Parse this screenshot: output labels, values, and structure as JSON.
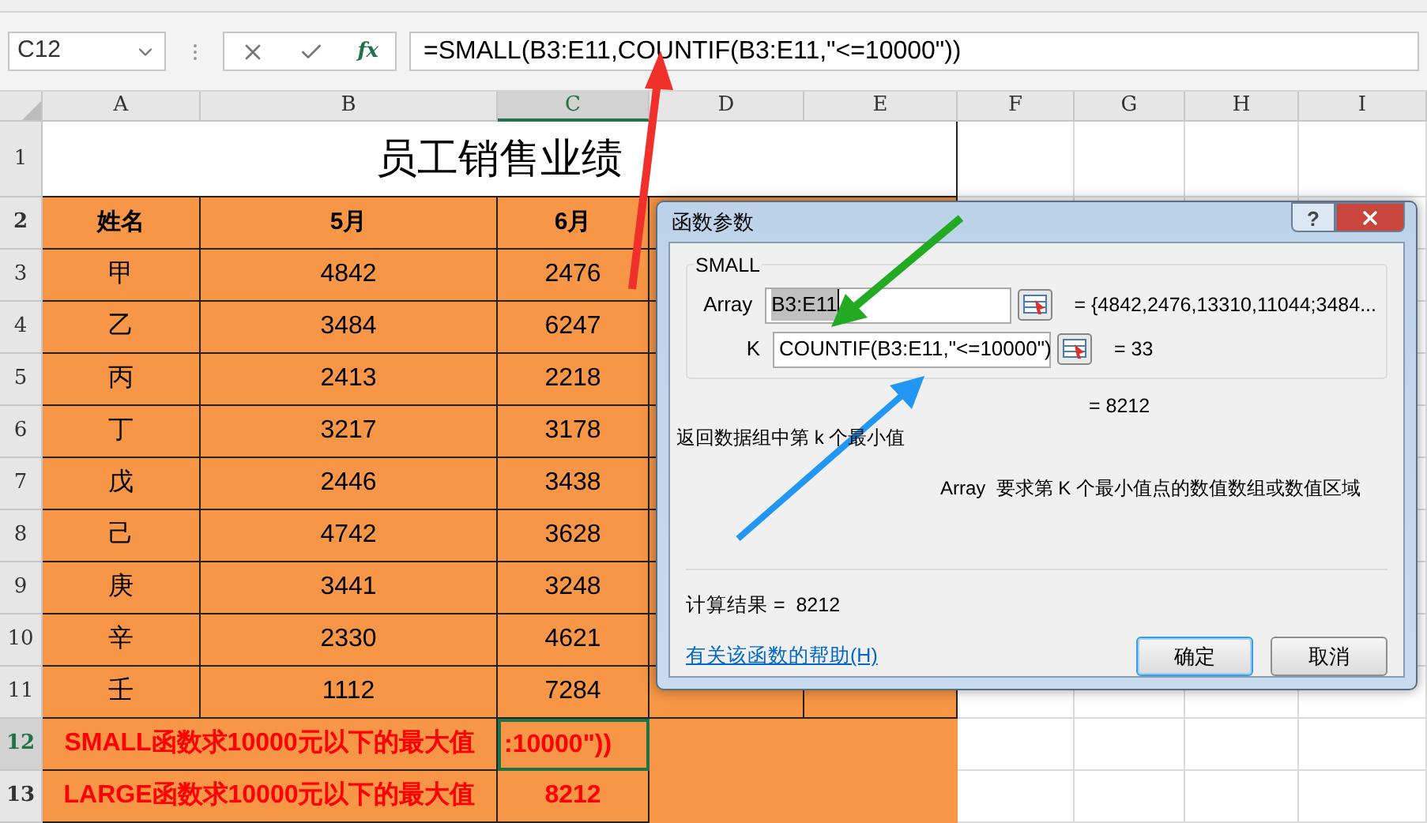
{
  "name_box": {
    "value": "C12"
  },
  "formula_bar": {
    "fx_label": "fx",
    "value": "=SMALL(B3:E11,COUNTIF(B3:E11,\"<=10000\"))"
  },
  "columns": [
    {
      "label": "A",
      "selected": false
    },
    {
      "label": "B",
      "selected": false
    },
    {
      "label": "C",
      "selected": true
    },
    {
      "label": "D",
      "selected": false
    },
    {
      "label": "E",
      "selected": false
    },
    {
      "label": "F",
      "selected": false
    },
    {
      "label": "G",
      "selected": false
    },
    {
      "label": "H",
      "selected": false
    },
    {
      "label": "I",
      "selected": false
    }
  ],
  "row_numbers": [
    {
      "label": "1",
      "selected": false
    },
    {
      "label": "2",
      "selected": false
    },
    {
      "label": "3",
      "selected": false
    },
    {
      "label": "4",
      "selected": false
    },
    {
      "label": "5",
      "selected": false
    },
    {
      "label": "6",
      "selected": false
    },
    {
      "label": "7",
      "selected": false
    },
    {
      "label": "8",
      "selected": false
    },
    {
      "label": "9",
      "selected": false
    },
    {
      "label": "10",
      "selected": false
    },
    {
      "label": "11",
      "selected": false
    },
    {
      "label": "12",
      "selected": true
    },
    {
      "label": "13",
      "selected": false
    }
  ],
  "sheet": {
    "title": "员工销售业绩",
    "headers": [
      "姓名",
      "5月",
      "6月"
    ],
    "rows": [
      {
        "name": "甲",
        "may": "4842",
        "june": "2476"
      },
      {
        "name": "乙",
        "may": "3484",
        "june": "6247"
      },
      {
        "name": "丙",
        "may": "2413",
        "june": "2218"
      },
      {
        "name": "丁",
        "may": "3217",
        "june": "3178"
      },
      {
        "name": "戊",
        "may": "2446",
        "june": "3438"
      },
      {
        "name": "己",
        "may": "4742",
        "june": "3628"
      },
      {
        "name": "庚",
        "may": "3441",
        "june": "3248"
      },
      {
        "name": "辛",
        "may": "2330",
        "june": "4621"
      },
      {
        "name": "壬",
        "may": "1112",
        "june": "7284"
      }
    ],
    "summary": [
      {
        "label": "SMALL函数求10000元以下的最大值",
        "value": ":10000\"))",
        "selected": true
      },
      {
        "label": "LARGE函数求10000元以下的最大值",
        "value": "8212",
        "selected": false
      }
    ]
  },
  "dialog": {
    "title": "函数参数",
    "help_button": "?",
    "function_name": "SMALL",
    "args": [
      {
        "label": "Array",
        "value": "B3:E11",
        "result": "= {4842,2476,13310,11044;3484...",
        "selected": true
      },
      {
        "label": "K",
        "value": "COUNTIF(B3:E11,\"<=10000\")",
        "result": "= 33",
        "selected": false
      }
    ],
    "formula_result": "= 8212",
    "description": "返回数据组中第 k 个最小值",
    "arg_help": "Array  要求第 K 个最小值点的数值数组或数值区域",
    "calc_result": "计算结果 =  8212",
    "help_link": "有关该函数的帮助(H)",
    "buttons": [
      {
        "label": "确定",
        "default": true
      },
      {
        "label": "取消",
        "default": false
      }
    ]
  }
}
